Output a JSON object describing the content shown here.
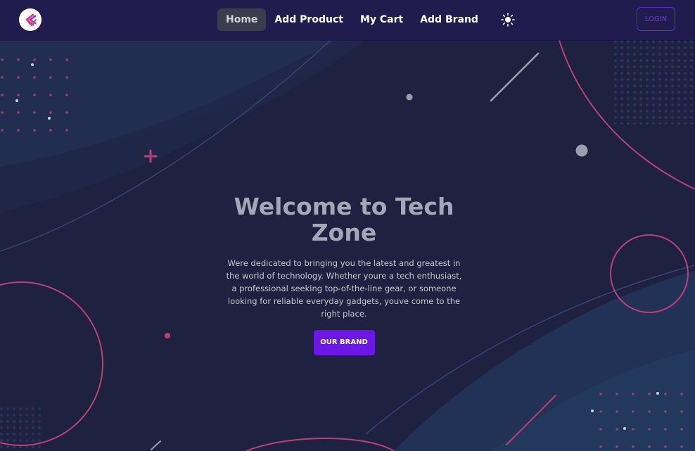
{
  "nav": {
    "links": [
      {
        "label": "Home",
        "active": true
      },
      {
        "label": "Add Product",
        "active": false
      },
      {
        "label": "My Cart",
        "active": false
      },
      {
        "label": "Add Brand",
        "active": false
      }
    ],
    "theme_icon": "sun-icon",
    "login_label": "LOGIN"
  },
  "logo": {
    "icon": "tech-zone-logo-icon"
  },
  "hero": {
    "title": "Welcome to Tech Zone",
    "description": "Were dedicated to bringing you the latest and greatest in the world of technology. Whether youre a tech enthusiast, a professional seeking top-of-the-line gear, or someone looking for reliable everyday gadgets, youve come to the right place.",
    "button_label": "OUR BRAND"
  },
  "colors": {
    "navbar": "#221c4e",
    "hero_background": "#1e2140",
    "accent_button": "#6a17e8",
    "login_border": "#5b2bd9",
    "decoration_pink": "#c2447f",
    "title": "#a3a8b5"
  }
}
